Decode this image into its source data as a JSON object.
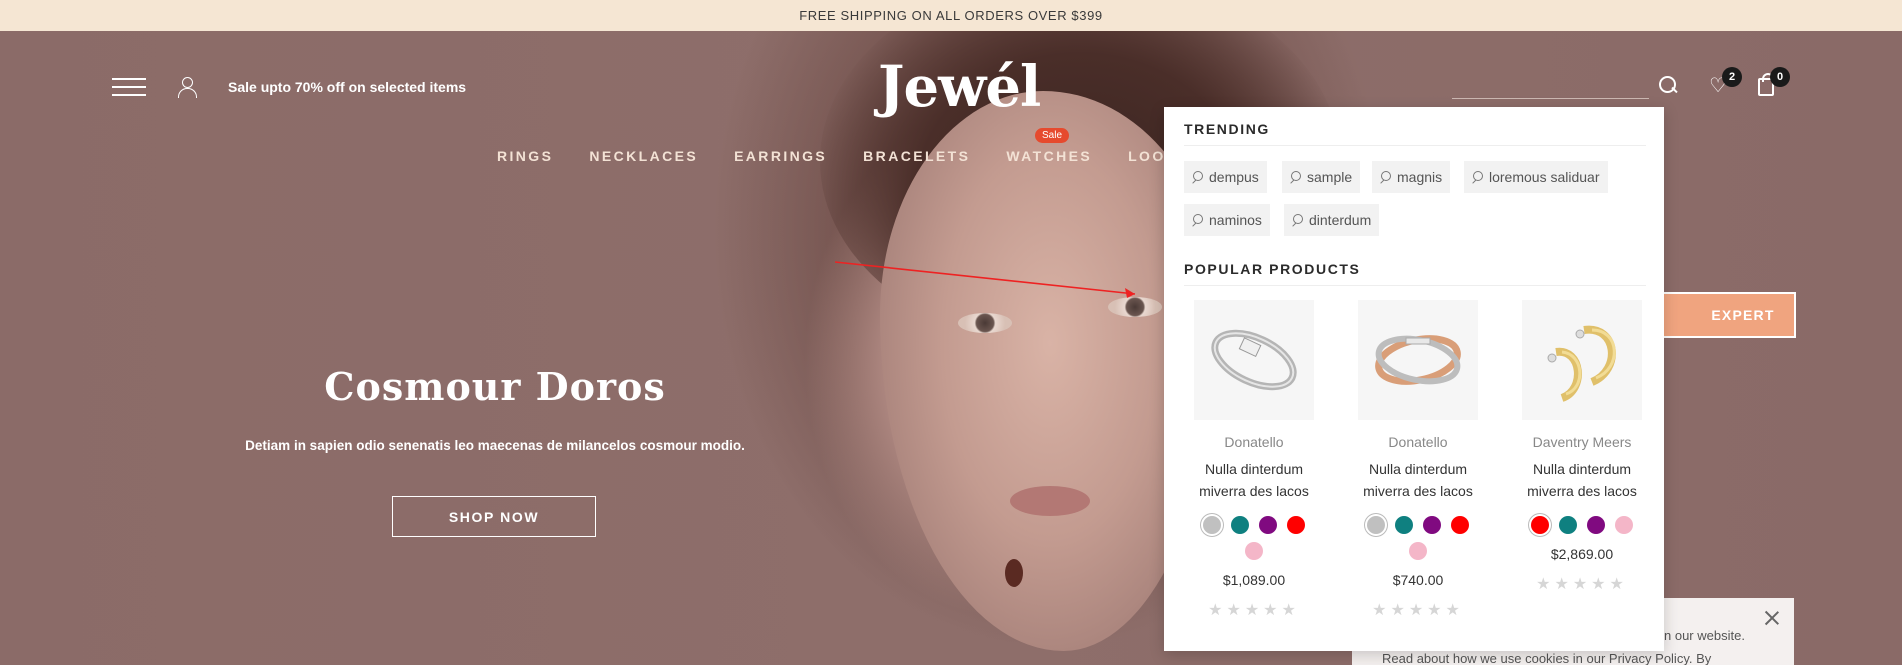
{
  "topbar": {
    "text": "FREE SHIPPING ON ALL ORDERS OVER $399"
  },
  "header": {
    "sale_text": "Sale upto 70% off on selected items",
    "logo": "Jewél",
    "wishlist_count": "2",
    "cart_count": "0"
  },
  "nav": {
    "items": [
      "RINGS",
      "NECKLACES",
      "EARRINGS",
      "BRACELETS",
      "WATCHES",
      "LOOKB"
    ],
    "sale_badge": "Sale"
  },
  "hero": {
    "title": "Cosmour Doros",
    "subtitle": "Detiam in sapien odio senenatis leo maecenas de milancelos cosmour modio.",
    "button": "SHOP NOW",
    "expert_button": "EXPERT"
  },
  "search_dropdown": {
    "trending_title": "TRENDING",
    "trending": [
      "dempus",
      "sample",
      "magnis",
      "loremous saliduar",
      "naminos",
      "dinterdum"
    ],
    "popular_title": "POPULAR PRODUCTS",
    "products": [
      {
        "brand": "Donatello",
        "name_line1": "Nulla dinterdum",
        "name_line2": "miverra des lacos",
        "price": "$1,089.00",
        "rating": 0,
        "swatches": [
          "#c0c0c0",
          "#0f8080",
          "#800a80",
          "#ff0000",
          "#f4b6c8"
        ],
        "selected_swatch": 0
      },
      {
        "brand": "Donatello",
        "name_line1": "Nulla dinterdum",
        "name_line2": "miverra des lacos",
        "price": "$740.00",
        "rating": 0,
        "swatches": [
          "#c0c0c0",
          "#0f8080",
          "#800a80",
          "#ff0000",
          "#f4b6c8"
        ],
        "selected_swatch": 0
      },
      {
        "brand": "Daventry Meers",
        "name_line1": "Nulla dinterdum",
        "name_line2": "miverra des lacos",
        "price": "$2,869.00",
        "rating": 0,
        "swatches": [
          "#ff0000",
          "#0f8080",
          "#800a80",
          "#f4b6c8"
        ],
        "selected_swatch": 0
      }
    ]
  },
  "cookie": {
    "line1": "n our website.",
    "line2": "Read about how we use cookies in our Privacy Policy. By"
  },
  "colors": {
    "accent": "#f0a47f",
    "sale_badge": "#e64a2e",
    "hero_bg": "#8c6b68",
    "topbar_bg": "#f5e6d3"
  }
}
